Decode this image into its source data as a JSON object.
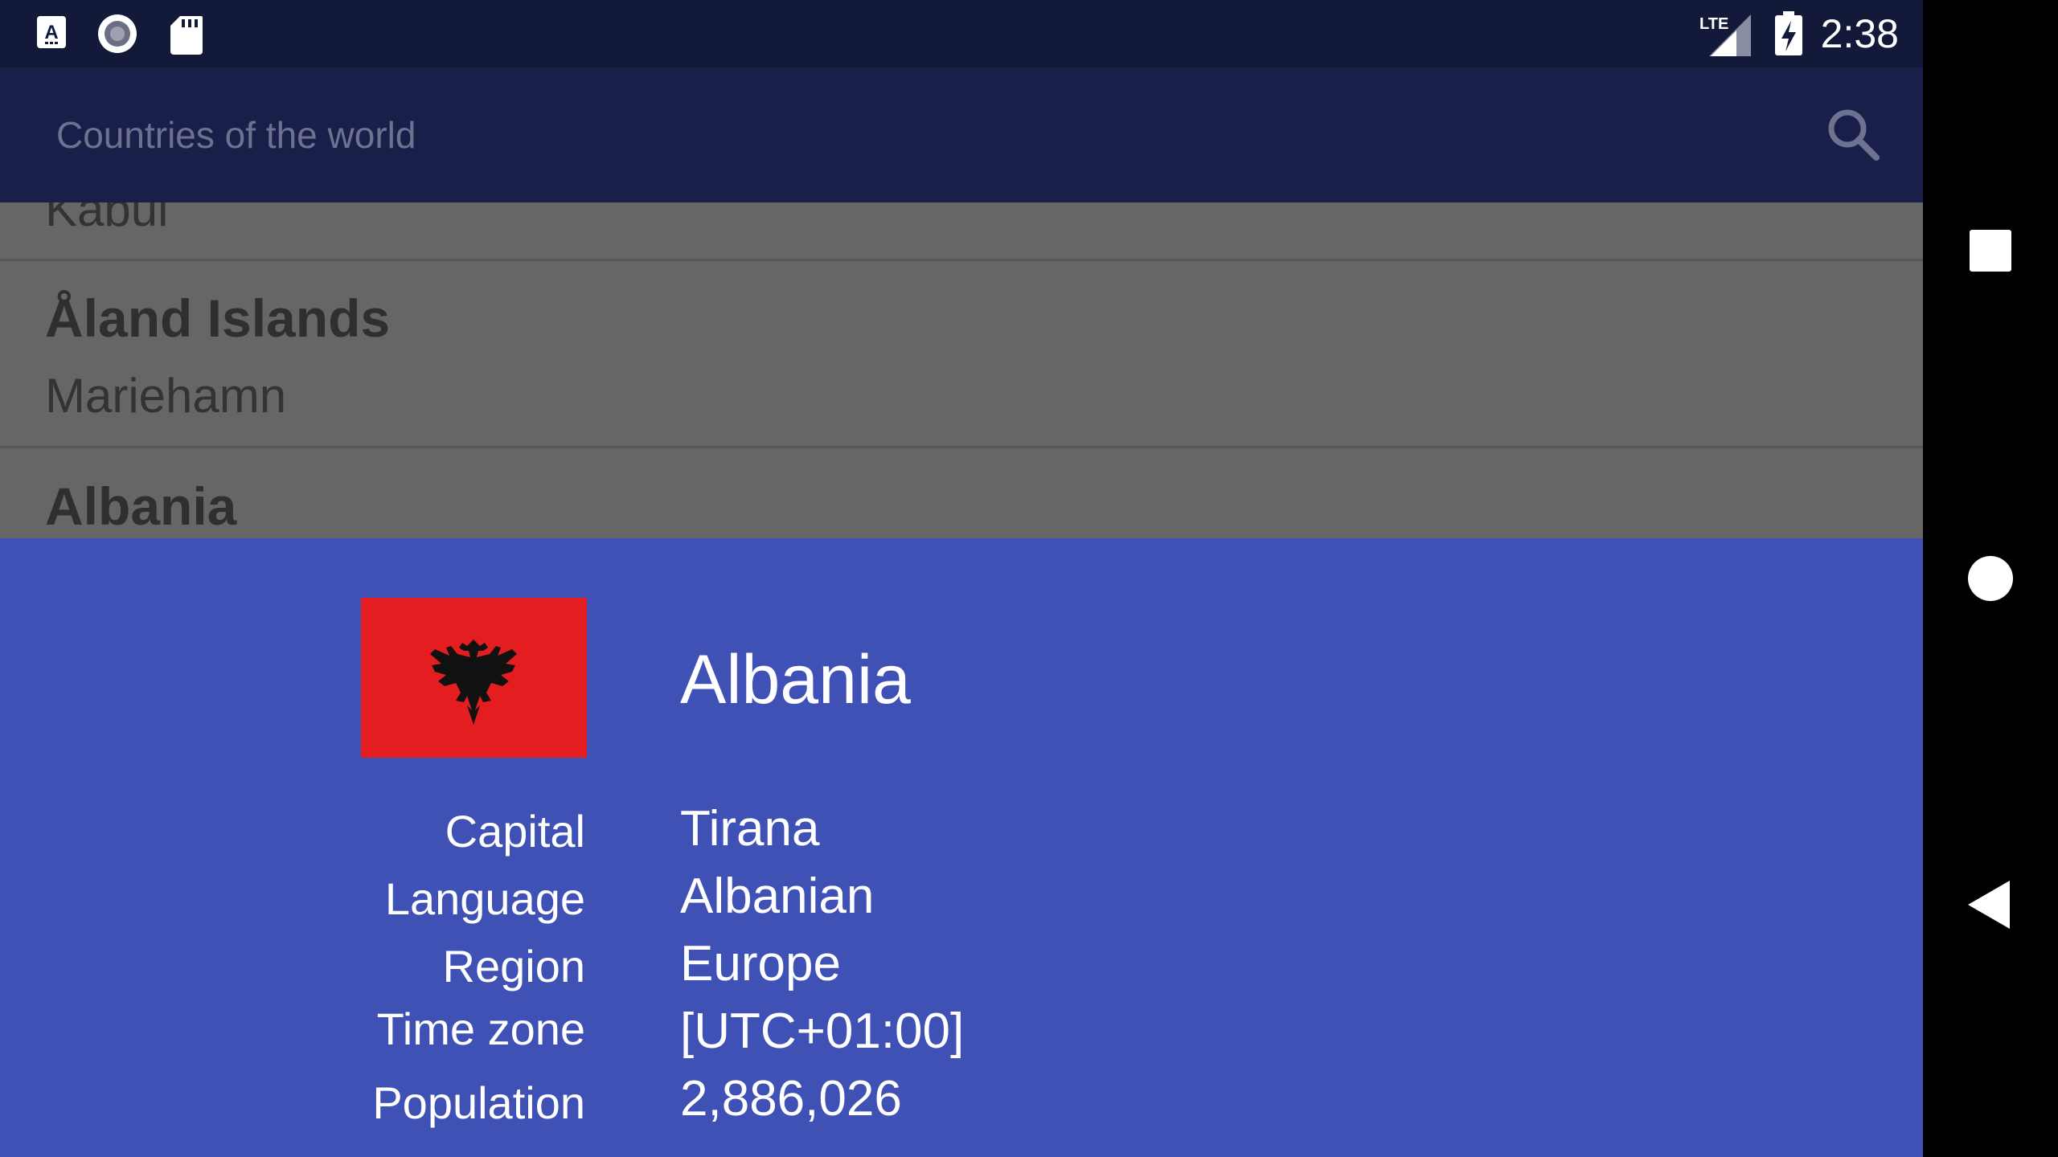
{
  "status_bar": {
    "time": "2:38",
    "network": "LTE",
    "icons": [
      "a-keyboard-icon",
      "record-icon",
      "sd-card-icon",
      "lte-signal-icon",
      "battery-charging-icon"
    ]
  },
  "app_bar": {
    "title": "Countries of the world",
    "search_icon": "search-icon"
  },
  "list": {
    "items": [
      {
        "name": "",
        "capital": "Kabul"
      },
      {
        "name": "Åland Islands",
        "capital": "Mariehamn"
      },
      {
        "name": "Albania",
        "capital": ""
      }
    ]
  },
  "detail": {
    "country": "Albania",
    "flag_icon": "albania-flag-icon",
    "fields": [
      {
        "label": "Capital",
        "value": "Tirana"
      },
      {
        "label": "Language",
        "value": "Albanian"
      },
      {
        "label": "Region",
        "value": "Europe"
      },
      {
        "label": "Time zone",
        "value": "[UTC+01:00]"
      },
      {
        "label": "Population",
        "value": "2,886,026"
      }
    ]
  },
  "nav_bar": {
    "buttons": [
      "overview-square-icon",
      "home-circle-icon",
      "back-triangle-icon"
    ]
  },
  "colors": {
    "status_bar": "#131938",
    "app_bar": "#1a1f49",
    "sheet": "#3f51b5",
    "list_bg": "#666666",
    "flag_red": "#e41e20"
  }
}
